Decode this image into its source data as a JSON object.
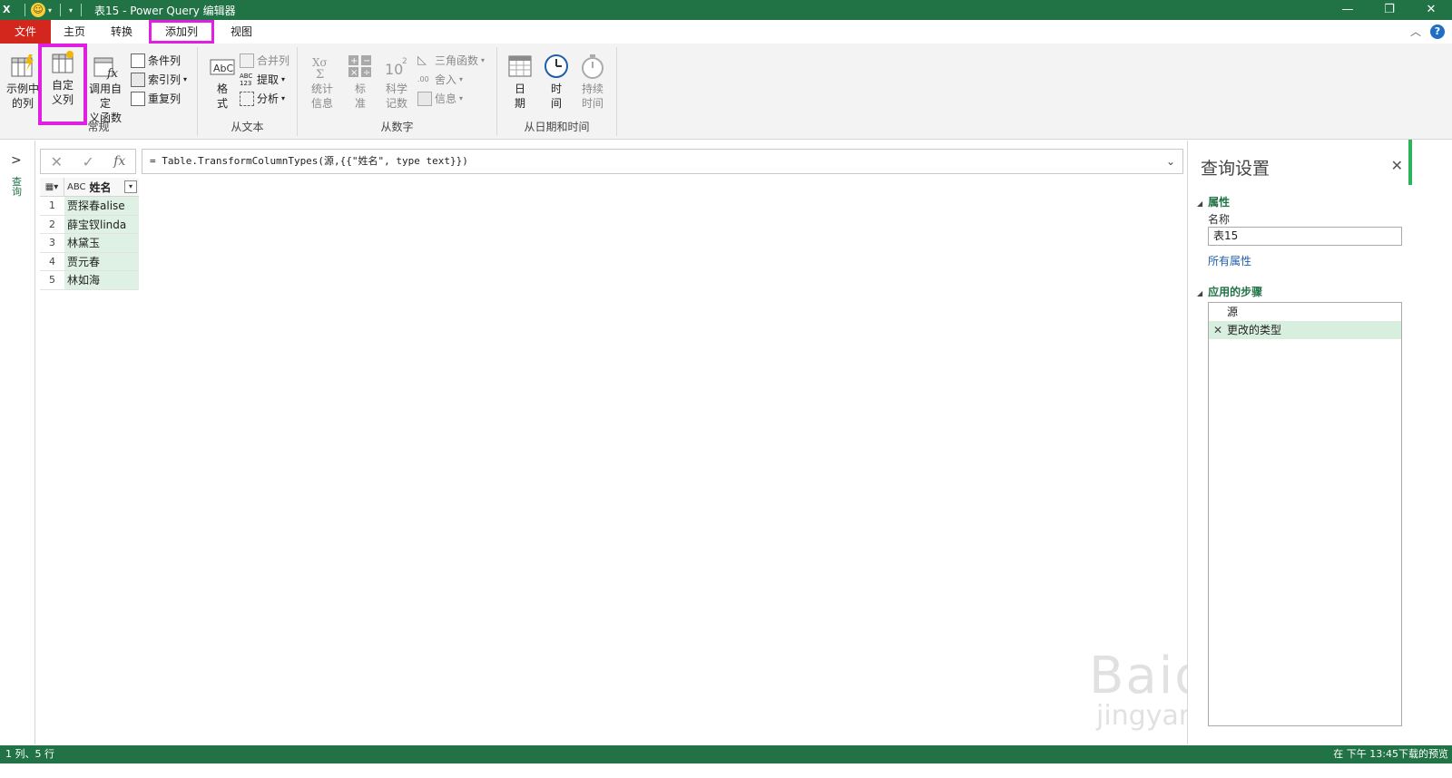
{
  "window": {
    "title": "表15 - Power Query 编辑器",
    "app_icon": "excel-icon"
  },
  "tabs": [
    {
      "label": "文件"
    },
    {
      "label": "主页"
    },
    {
      "label": "转换"
    },
    {
      "label": "添加列"
    },
    {
      "label": "视图"
    }
  ],
  "ribbon": {
    "general": {
      "group_label": "常规",
      "example_col": "示例中\n的列",
      "custom_col": "自定\n义列",
      "invoke_fn": "调用自定\n义函数",
      "conditional": "条件列",
      "index": "索引列",
      "duplicate": "重复列"
    },
    "text": {
      "group_label": "从文本",
      "format": "格\n式",
      "merge": "合并列",
      "extract": "提取",
      "parse": "分析"
    },
    "number": {
      "group_label": "从数字",
      "stats": "统计\n信息",
      "standard": "标\n准",
      "scientific": "科学\n记数",
      "trig": "三角函数",
      "round": "舍入",
      "info": "信息"
    },
    "datetime": {
      "group_label": "从日期和时间",
      "date": "日\n期",
      "time": "时\n间",
      "duration": "持续\n时间"
    }
  },
  "leftnav": {
    "label": "查询"
  },
  "formula": {
    "text": "= Table.TransformColumnTypes(源,{{\"姓名\", type text}})"
  },
  "table": {
    "column": "姓名",
    "type_label": "ABC",
    "rows": [
      {
        "n": "1",
        "v": "贾探春alise"
      },
      {
        "n": "2",
        "v": "薛宝钗linda"
      },
      {
        "n": "3",
        "v": "林黛玉"
      },
      {
        "n": "4",
        "v": "贾元春"
      },
      {
        "n": "5",
        "v": "林如海"
      }
    ]
  },
  "settings": {
    "title": "查询设置",
    "properties_label": "属性",
    "name_label": "名称",
    "name_value": "表15",
    "all_props": "所有属性",
    "steps_label": "应用的步骤",
    "steps": [
      "源",
      "更改的类型"
    ]
  },
  "status": {
    "left": "1 列、5 行",
    "right": "在 下午 13:45下载的预览"
  },
  "watermark": {
    "big": "Baidu经验",
    "small": "jingyan.baidu.com"
  }
}
